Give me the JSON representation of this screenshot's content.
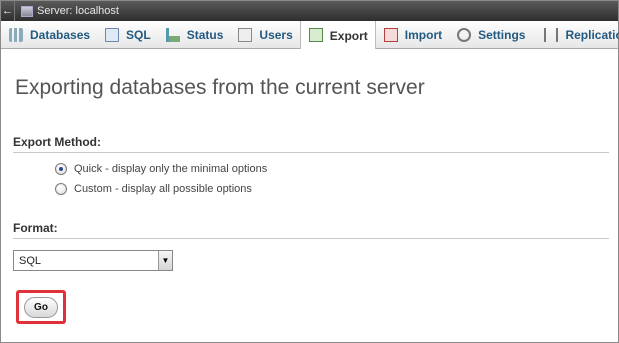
{
  "serverbar": {
    "back_glyph": "←",
    "server_label": "Server: localhost"
  },
  "tabs": [
    {
      "label": "Databases",
      "icon": "databases-icon"
    },
    {
      "label": "SQL",
      "icon": "sql-icon"
    },
    {
      "label": "Status",
      "icon": "status-icon"
    },
    {
      "label": "Users",
      "icon": "users-icon"
    },
    {
      "label": "Export",
      "icon": "export-icon",
      "active": true
    },
    {
      "label": "Import",
      "icon": "import-icon"
    },
    {
      "label": "Settings",
      "icon": "settings-icon"
    },
    {
      "label": "Replication",
      "icon": "replication-icon"
    }
  ],
  "main": {
    "title": "Exporting databases from the current server",
    "export_method": {
      "heading": "Export Method:",
      "options": [
        {
          "label": "Quick - display only the minimal options",
          "checked": true
        },
        {
          "label": "Custom - display all possible options",
          "checked": false
        }
      ]
    },
    "format": {
      "heading": "Format:",
      "selected": "SQL"
    },
    "go_label": "Go"
  },
  "colors": {
    "tab_link": "#235a81",
    "highlight_outline": "#e0303a"
  }
}
